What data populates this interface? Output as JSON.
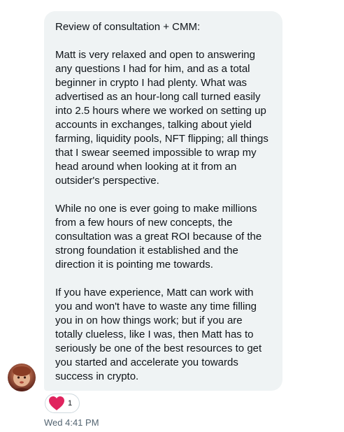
{
  "message": {
    "paragraphs": [
      "Review of consultation + CMM:",
      "Matt is very relaxed and open to answering any questions I had for him, and as a total beginner in crypto I had plenty. What was advertised as an hour-long call turned easily into 2.5 hours where we worked on setting up accounts in exchanges, talking about yield farming, liquidity pools, NFT flipping; all things that I swear seemed impossible to wrap my head around when looking at it from an outsider's perspective.",
      "While no one is ever going to make millions from a few hours of new concepts, the consultation was a great ROI because of the strong foundation it established and the direction it is pointing me towards.",
      "If you have experience, Matt can work with you and won't have to waste any time filling you in on how things work; but if you are totally clueless, like I was, then Matt has to seriously be one of the best resources to get you started and accelerate you towards success in crypto."
    ]
  },
  "reaction": {
    "icon": "heart-icon",
    "count": "1",
    "color": "#f91880"
  },
  "timestamp": "Wed 4:41 PM",
  "colors": {
    "bubble_bg": "#eff3f4",
    "text": "#0f1419",
    "muted": "#536471"
  }
}
